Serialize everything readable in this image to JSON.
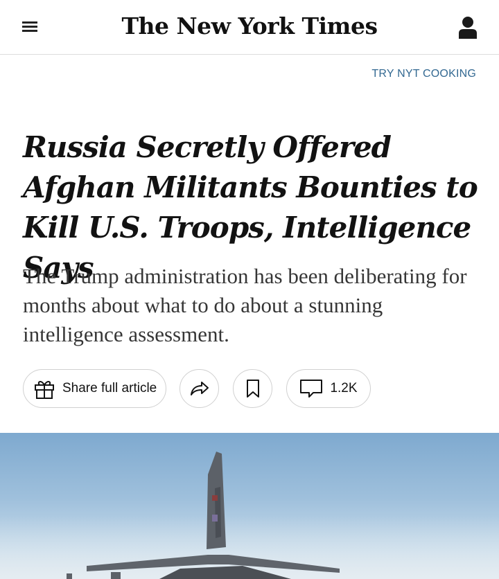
{
  "header": {
    "masthead": "The New York Times",
    "menu_icon": "hamburger-menu-icon",
    "account_icon": "user-account-icon"
  },
  "promo": {
    "label": "TRY NYT COOKING"
  },
  "article": {
    "headline": "Russia Secretly Offered Afghan Militants Bounties to Kill U.S. Troops, Intelligence Says",
    "summary": "The Trump administration has been deliberating for months about what to do about a stunning intelligence assessment."
  },
  "actions": {
    "share_label": "Share full article",
    "share_icon": "gift-icon",
    "forward_icon": "share-arrow-icon",
    "save_icon": "bookmark-icon",
    "comment_icon": "comment-icon",
    "comment_count": "1.2K"
  },
  "colors": {
    "link": "#326891",
    "text": "#121212",
    "summary": "#363636",
    "border": "#d0d0d0"
  }
}
